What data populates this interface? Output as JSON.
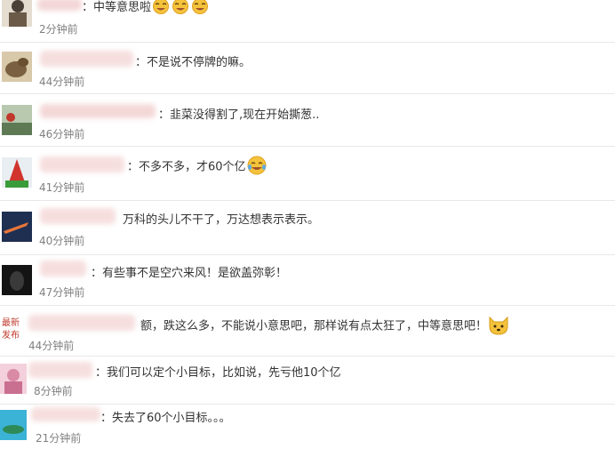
{
  "comments": [
    {
      "text": "：中等意思啦",
      "time": "2分钟前",
      "trailing_icons": [
        "laughing-emoji-icon",
        "laughing-emoji-icon",
        "laughing-emoji-icon"
      ]
    },
    {
      "text": "：不是说不停牌的嘛。",
      "time": "44分钟前"
    },
    {
      "text": "：韭菜没得割了,现在开始撕葱..",
      "time": "46分钟前"
    },
    {
      "text": "：不多不多，才60个亿",
      "time": "41分钟前",
      "trailing_icons": [
        "tears-of-joy-emoji-icon"
      ]
    },
    {
      "text": "万科的头儿不干了，万达想表示表示。",
      "time": "40分钟前"
    },
    {
      "text": "：有些事不是空穴来风！是欲盖弥彰！",
      "time": "47分钟前"
    },
    {
      "text": "额，跌这么多，不能说小意思吧，那样说有点太狂了，中等意思吧！",
      "time": "44分钟前",
      "trailing_icons": [
        "dog-face-emoji-icon"
      ]
    },
    {
      "text": "：我们可以定个小目标，比如说，先亏他10个亿",
      "time": "8分钟前"
    },
    {
      "text": "：失去了60个小目标。。。",
      "time": "21分钟前"
    }
  ],
  "colors": {
    "text": "#333333",
    "time": "#808080",
    "separator": "#e8e8e8",
    "emoji": "#f5c33b"
  }
}
